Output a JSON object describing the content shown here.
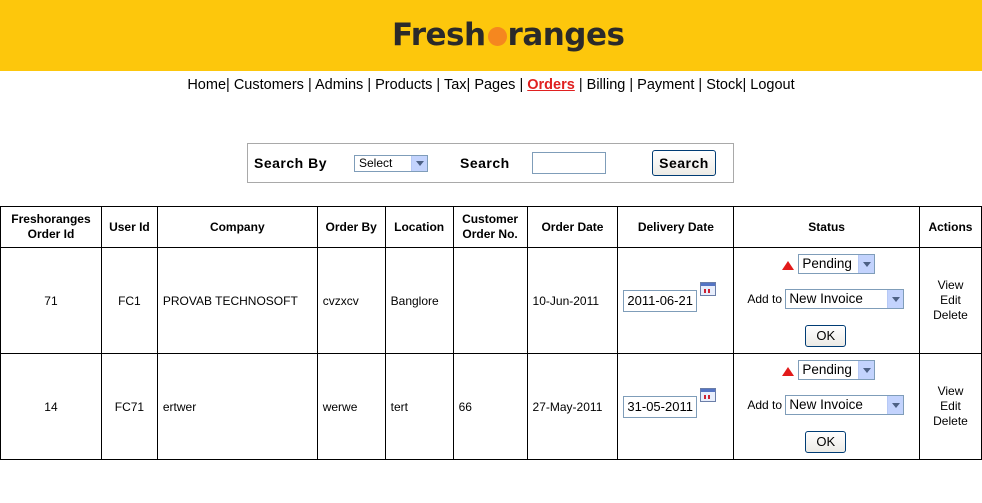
{
  "brand": {
    "part1": "Fresh",
    "part2": "ranges",
    "accent": "#f5871f",
    "header_bg": "#fdc70c"
  },
  "nav": [
    {
      "label": "Home"
    },
    {
      "label": "Customers"
    },
    {
      "label": "Admins"
    },
    {
      "label": "Products"
    },
    {
      "label": "Tax"
    },
    {
      "label": "Pages"
    },
    {
      "label": "Orders",
      "active": true
    },
    {
      "label": "Billing"
    },
    {
      "label": "Payment"
    },
    {
      "label": "Stock"
    },
    {
      "label": "Logout"
    }
  ],
  "search": {
    "search_by_label": "Search By",
    "select_value": "Select",
    "search_label": "Search",
    "input_value": "",
    "button_label": "Search"
  },
  "table": {
    "headers": {
      "order_id": [
        "Freshoranges",
        "Order Id"
      ],
      "user_id": "User Id",
      "company": "Company",
      "order_by": "Order By",
      "location": "Location",
      "customer_order_no": [
        "Customer",
        "Order No."
      ],
      "order_date": "Order Date",
      "delivery_date": "Delivery Date",
      "status": "Status",
      "actions": "Actions"
    },
    "rows": [
      {
        "order_id": "71",
        "user_id": "FC1",
        "company": "PROVAB TECHNOSOFT",
        "order_by": "cvzxcv",
        "location": "Banglore",
        "customer_order_no": "",
        "order_date": "10-Jun-2011",
        "delivery_date": "2011-06-21",
        "status": "Pending",
        "add_to_label": "Add to",
        "add_to_value": "New Invoice",
        "ok_label": "OK",
        "actions": {
          "view": "View",
          "edit": "Edit",
          "delete": "Delete"
        }
      },
      {
        "order_id": "14",
        "user_id": "FC71",
        "company": "ertwer",
        "order_by": "werwe",
        "location": "tert",
        "customer_order_no": "66",
        "order_date": "27-May-2011",
        "delivery_date": "31-05-2011",
        "status": "Pending",
        "add_to_label": "Add to",
        "add_to_value": "New Invoice",
        "ok_label": "OK",
        "actions": {
          "view": "View",
          "edit": "Edit",
          "delete": "Delete"
        }
      }
    ]
  }
}
